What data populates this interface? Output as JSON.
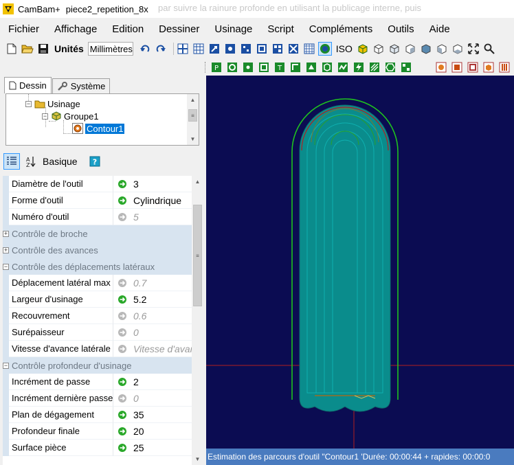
{
  "window": {
    "app_name": "CamBam+",
    "document": "piece2_repetition_8x",
    "ghost_text": "par suivre la rainure profonde en utilisant la publicage interne, puis"
  },
  "menu": [
    "Fichier",
    "Affichage",
    "Edition",
    "Dessiner",
    "Usinage",
    "Script",
    "Compléments",
    "Outils",
    "Aide"
  ],
  "toolbar": {
    "units_label": "Unités",
    "units_value": "Millimètres",
    "iso_label": "ISO"
  },
  "tabs": {
    "dessin": "Dessin",
    "systeme": "Système"
  },
  "tree": {
    "usinage": "Usinage",
    "groupe": "Groupe1",
    "contour": "Contour1"
  },
  "properties": {
    "mode_label": "Basique",
    "rows": [
      {
        "type": "prop",
        "name": "Diamètre de l'outil",
        "value": "3",
        "dim": false
      },
      {
        "type": "prop",
        "name": "Forme d'outil",
        "value": "Cylindrique",
        "dim": false
      },
      {
        "type": "prop",
        "name": "Numéro d'outil",
        "value": "5",
        "dim": true
      },
      {
        "type": "cat",
        "name": "Contrôle de broche"
      },
      {
        "type": "cat",
        "name": "Contrôle des avances"
      },
      {
        "type": "catopen",
        "name": "Contrôle des déplacements latéraux"
      },
      {
        "type": "prop",
        "name": "Déplacement latéral max",
        "value": "0.7",
        "dim": true
      },
      {
        "type": "prop",
        "name": "Largeur d'usinage",
        "value": "5.2",
        "dim": false
      },
      {
        "type": "prop",
        "name": "Recouvrement",
        "value": "0.6",
        "dim": true
      },
      {
        "type": "prop",
        "name": "Surépaisseur",
        "value": "0",
        "dim": true
      },
      {
        "type": "prop",
        "name": "Vitesse d'avance latérale",
        "value": "Vitesse d'avance",
        "dim": true
      },
      {
        "type": "catopen",
        "name": "Contrôle profondeur d'usinage"
      },
      {
        "type": "prop",
        "name": "Incrément de passe",
        "value": "2",
        "dim": false
      },
      {
        "type": "prop",
        "name": "Incrément dernière passe",
        "value": "0",
        "dim": true
      },
      {
        "type": "prop",
        "name": "Plan de dégagement",
        "value": "35",
        "dim": false
      },
      {
        "type": "prop",
        "name": "Profondeur finale",
        "value": "20",
        "dim": false
      },
      {
        "type": "prop",
        "name": "Surface pièce",
        "value": "25",
        "dim": false
      }
    ]
  },
  "status": {
    "text": "Estimation des parcours d'outil \"Contour1 'Durée: 00:00:44 + rapides: 00:00:0"
  },
  "colors": {
    "canvas_bg": "#0b0c52",
    "toolpath_fill": "#0a8c8c",
    "outline_green": "#1fc21f",
    "axis_red": "#b21f1f",
    "status_bg": "#4a7bbf"
  }
}
